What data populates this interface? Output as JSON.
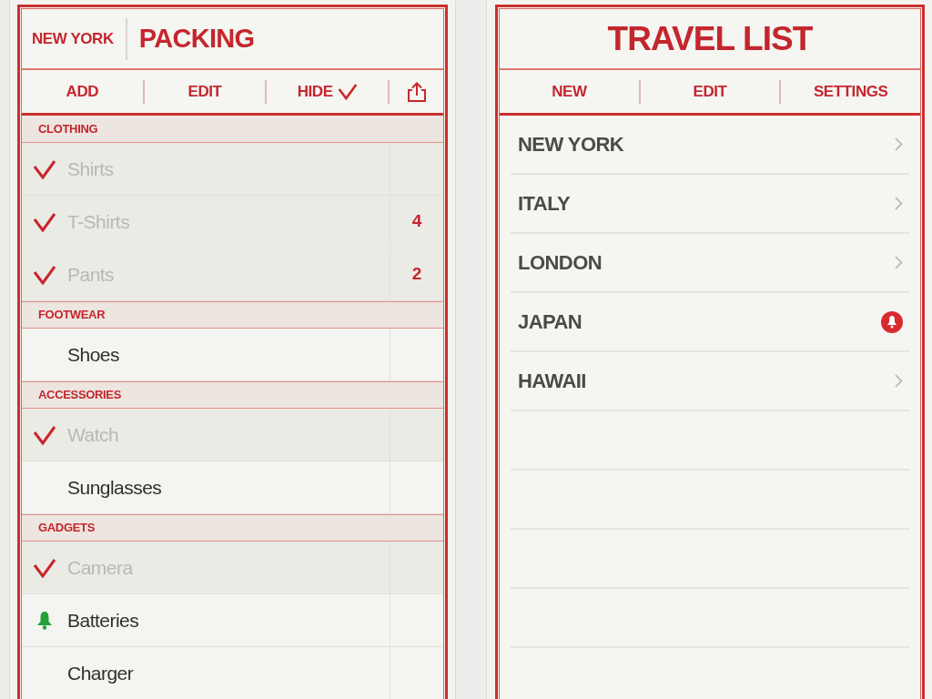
{
  "packing": {
    "trip": "NEW YORK",
    "title": "PACKING",
    "toolbar": [
      {
        "kind": "text",
        "label": "ADD"
      },
      {
        "kind": "text",
        "label": "EDIT"
      },
      {
        "kind": "text-check",
        "label": "HIDE"
      },
      {
        "kind": "share"
      }
    ],
    "sections": [
      {
        "title": "CLOTHING",
        "items": [
          {
            "name": "Shirts",
            "checked": true,
            "reminder": false
          },
          {
            "name": "T-Shirts",
            "checked": true,
            "reminder": false,
            "count": "4"
          },
          {
            "name": "Pants",
            "checked": true,
            "reminder": false,
            "count": "2"
          }
        ]
      },
      {
        "title": "FOOTWEAR",
        "items": [
          {
            "name": "Shoes",
            "checked": false,
            "reminder": false
          }
        ]
      },
      {
        "title": "ACCESSORIES",
        "items": [
          {
            "name": "Watch",
            "checked": true,
            "reminder": false
          },
          {
            "name": "Sunglasses",
            "checked": false,
            "reminder": false
          }
        ]
      },
      {
        "title": "GADGETS",
        "items": [
          {
            "name": "Camera",
            "checked": true,
            "reminder": false
          },
          {
            "name": "Batteries",
            "checked": false,
            "reminder": true
          },
          {
            "name": "Charger",
            "checked": false,
            "reminder": false
          }
        ]
      }
    ]
  },
  "travel_list": {
    "title": "TRAVEL LIST",
    "toolbar": [
      "NEW",
      "EDIT",
      "SETTINGS"
    ],
    "trips": [
      {
        "name": "NEW YORK",
        "alert": false
      },
      {
        "name": "ITALY",
        "alert": false
      },
      {
        "name": "LONDON",
        "alert": false
      },
      {
        "name": "JAPAN",
        "alert": true
      },
      {
        "name": "HAWAII",
        "alert": false
      }
    ]
  }
}
